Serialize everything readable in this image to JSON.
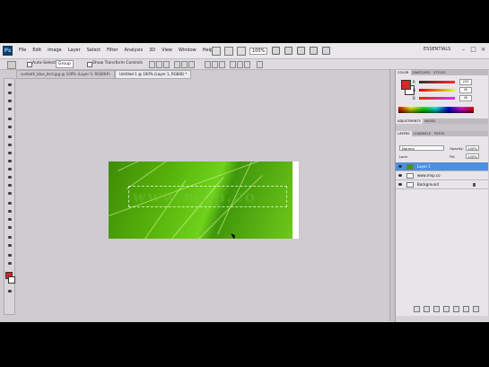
{
  "app": {
    "logo": "Ps",
    "workspace": "ESSENTIALS",
    "zoom": "100%"
  },
  "menu": [
    "File",
    "Edit",
    "Image",
    "Layer",
    "Select",
    "Filter",
    "Analysis",
    "3D",
    "View",
    "Window",
    "Help"
  ],
  "options": {
    "auto_select_label": "Auto-Select:",
    "auto_select_value": "Group",
    "transform_label": "Show Transform Controls"
  },
  "tabs": [
    {
      "label": "sunbath_blue_bird.jpg @ 100% (Layer 0, RGB/8#)",
      "active": false
    },
    {
      "label": "Untitled-1 @ 100% (Layer 1, RGB/8) *",
      "active": true
    }
  ],
  "canvas_text": "www.mnp.co",
  "color_panel": {
    "tabs": [
      "COLOR",
      "SWATCHES",
      "STYLES"
    ],
    "fg_color": "#d02a2a",
    "sliders": [
      {
        "label": "R",
        "value": "220"
      },
      {
        "label": "G",
        "value": "45"
      },
      {
        "label": "B",
        "value": "45"
      }
    ]
  },
  "adjust_tabs": [
    "ADJUSTMENTS",
    "MASKS"
  ],
  "layers_panel": {
    "tabs": [
      "LAYERS",
      "CHANNELS",
      "PATHS"
    ],
    "blend_mode": "Normal",
    "opacity_label": "Opacity:",
    "opacity": "100%",
    "lock_label": "Lock:",
    "fill_label": "Fill:",
    "fill": "100%",
    "layers": [
      {
        "name": "Layer 1",
        "selected": true,
        "thumb": "#3f9c10"
      },
      {
        "name": "www.mnp.co",
        "selected": false,
        "thumb": "#ffffff"
      },
      {
        "name": "Background",
        "selected": false,
        "thumb": "#ffffff"
      }
    ]
  }
}
